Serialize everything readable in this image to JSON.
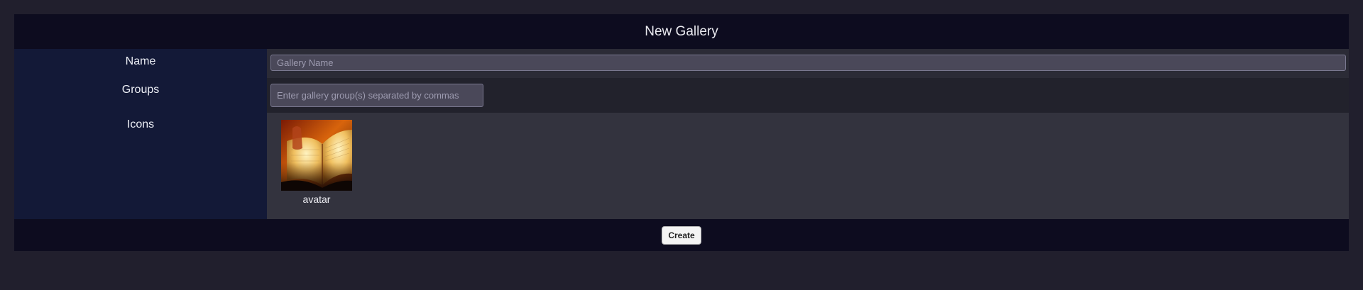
{
  "header": {
    "title": "New Gallery"
  },
  "form": {
    "name": {
      "label": "Name",
      "placeholder": "Gallery Name",
      "value": ""
    },
    "groups": {
      "label": "Groups",
      "placeholder": "Enter gallery group(s) separated by commas",
      "value": ""
    },
    "icons": {
      "label": "Icons",
      "items": [
        {
          "caption": "avatar",
          "icon": "open-book-image"
        }
      ]
    }
  },
  "footer": {
    "create_label": "Create"
  }
}
